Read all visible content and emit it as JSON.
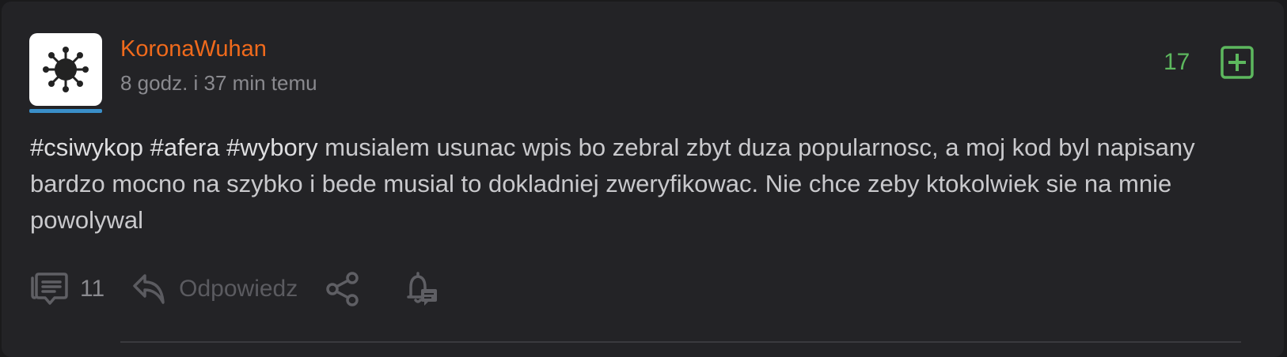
{
  "post": {
    "author": "KoronaWuhan",
    "time": "8 godz. i 37 min temu",
    "votes": "17",
    "avatar_icon": "virus-icon",
    "tags": [
      "#csiwykop",
      "#afera",
      "#wybory"
    ],
    "text": "musialem usunac wpis bo zebral zbyt duza popularnosc, a moj kod byl napisany bardzo mocno na szybko i bede musial to dokladniej zweryfikowac. Nie chce zeby ktokolwiek sie na mnie powolywal",
    "comments_count": "11",
    "reply_label": "Odpowiedz"
  },
  "colors": {
    "author": "#f06a1c",
    "votes": "#5db85e",
    "avatar_bar": "#3a8fc9",
    "background": "#232326"
  }
}
